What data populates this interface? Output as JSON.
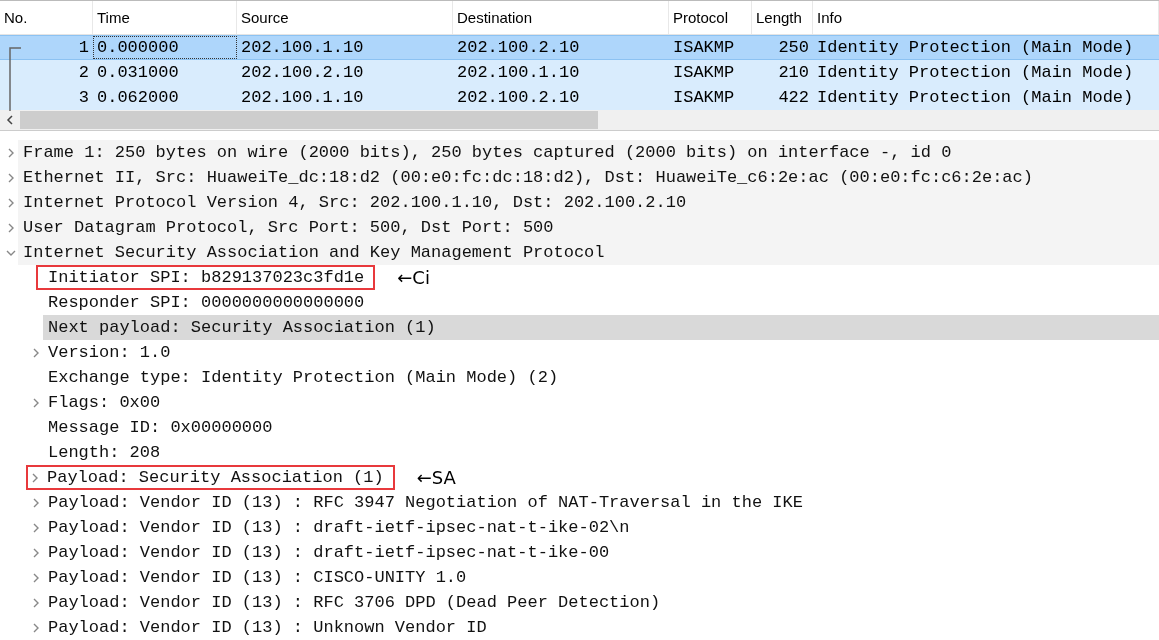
{
  "packet_list": {
    "columns": [
      "No.",
      "Time",
      "Source",
      "Destination",
      "Protocol",
      "Length",
      "Info"
    ],
    "rows": [
      {
        "selected": true,
        "cells": [
          "1",
          "0.000000",
          "202.100.1.10",
          "202.100.2.10",
          "ISAKMP",
          "250",
          "Identity Protection (Main Mode)"
        ]
      },
      {
        "selected": false,
        "cells": [
          "2",
          "0.031000",
          "202.100.2.10",
          "202.100.1.10",
          "ISAKMP",
          "210",
          "Identity Protection (Main Mode)"
        ]
      },
      {
        "selected": false,
        "cells": [
          "3",
          "0.062000",
          "202.100.1.10",
          "202.100.2.10",
          "ISAKMP",
          "422",
          "Identity Protection (Main Mode)"
        ]
      }
    ]
  },
  "details": [
    {
      "label": "Frame 1: 250 bytes on wire (2000 bits), 250 bytes captured (2000 bits) on interface -, id 0",
      "expandable": true,
      "expanded": false,
      "selected": false
    },
    {
      "label": "Ethernet II, Src: HuaweiTe_dc:18:d2 (00:e0:fc:dc:18:d2), Dst: HuaweiTe_c6:2e:ac (00:e0:fc:c6:2e:ac)",
      "expandable": true,
      "expanded": false,
      "selected": false
    },
    {
      "label": "Internet Protocol Version 4, Src: 202.100.1.10, Dst: 202.100.2.10",
      "expandable": true,
      "expanded": false,
      "selected": false
    },
    {
      "label": "User Datagram Protocol, Src Port: 500, Dst Port: 500",
      "expandable": true,
      "expanded": false,
      "selected": false
    },
    {
      "label": "Internet Security Association and Key Management Protocol",
      "expandable": true,
      "expanded": true,
      "selected": false,
      "children": [
        {
          "label": "Initiator SPI: b829137023c3fd1e",
          "expandable": false,
          "selected": false,
          "annotation": "←Ci"
        },
        {
          "label": "Responder SPI: 0000000000000000",
          "expandable": false,
          "selected": false
        },
        {
          "label": "Next payload: Security Association (1)",
          "expandable": false,
          "selected": true
        },
        {
          "label": "Version: 1.0",
          "expandable": true,
          "expanded": false,
          "selected": false
        },
        {
          "label": "Exchange type: Identity Protection (Main Mode) (2)",
          "expandable": false,
          "selected": false
        },
        {
          "label": "Flags: 0x00",
          "expandable": true,
          "expanded": false,
          "selected": false
        },
        {
          "label": "Message ID: 0x00000000",
          "expandable": false,
          "selected": false
        },
        {
          "label": "Length: 208",
          "expandable": false,
          "selected": false
        },
        {
          "label": "Payload: Security Association (1)",
          "expandable": true,
          "expanded": false,
          "selected": false,
          "annotation": "←SA"
        },
        {
          "label": "Payload: Vendor ID (13) : RFC 3947 Negotiation of NAT-Traversal in the IKE",
          "expandable": true,
          "expanded": false,
          "selected": false
        },
        {
          "label": "Payload: Vendor ID (13) : draft-ietf-ipsec-nat-t-ike-02\\n",
          "expandable": true,
          "expanded": false,
          "selected": false
        },
        {
          "label": "Payload: Vendor ID (13) : draft-ietf-ipsec-nat-t-ike-00",
          "expandable": true,
          "expanded": false,
          "selected": false
        },
        {
          "label": "Payload: Vendor ID (13) : CISCO-UNITY 1.0",
          "expandable": true,
          "expanded": false,
          "selected": false
        },
        {
          "label": "Payload: Vendor ID (13) : RFC 3706 DPD (Dead Peer Detection)",
          "expandable": true,
          "expanded": false,
          "selected": false
        },
        {
          "label": "Payload: Vendor ID (13) : Unknown Vendor ID",
          "expandable": true,
          "expanded": false,
          "selected": false
        }
      ]
    }
  ]
}
